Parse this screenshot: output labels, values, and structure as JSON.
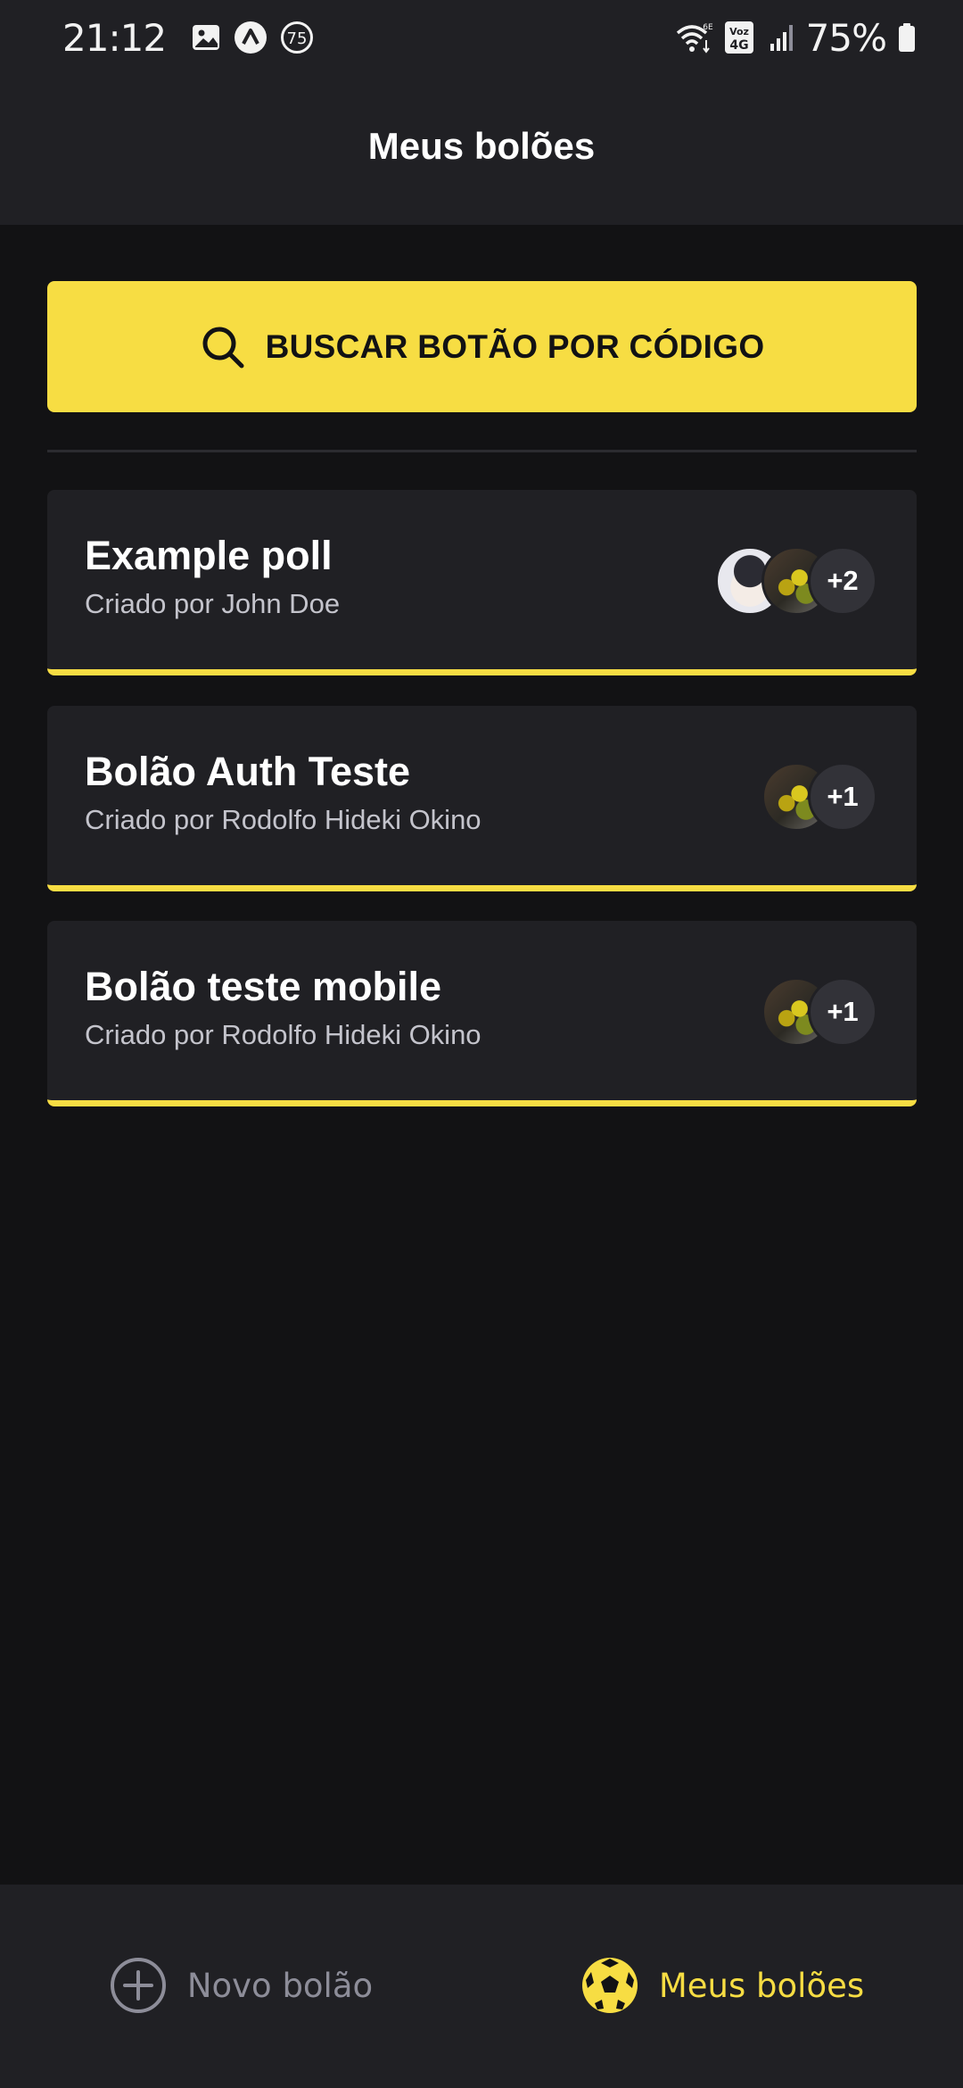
{
  "status_bar": {
    "time": "21:12",
    "notification_badge": "75",
    "battery": "75%",
    "network_label": "Voz 4G",
    "wifi_label": "6E"
  },
  "header": {
    "title": "Meus bolões"
  },
  "search": {
    "label": "BUSCAR BOTÃO POR CÓDIGO"
  },
  "polls": [
    {
      "title": "Example poll",
      "owner": "Criado por John Doe",
      "extra_count": "+2"
    },
    {
      "title": "Bolão Auth Teste",
      "owner": "Criado por Rodolfo Hideki Okino",
      "extra_count": "+1"
    },
    {
      "title": "Bolão teste mobile",
      "owner": "Criado por Rodolfo Hideki Okino",
      "extra_count": "+1"
    }
  ],
  "bottom_nav": {
    "new_poll": "Novo bolão",
    "my_polls": "Meus bolões"
  },
  "colors": {
    "accent": "#F7DD43",
    "background": "#121214",
    "surface": "#202024"
  }
}
